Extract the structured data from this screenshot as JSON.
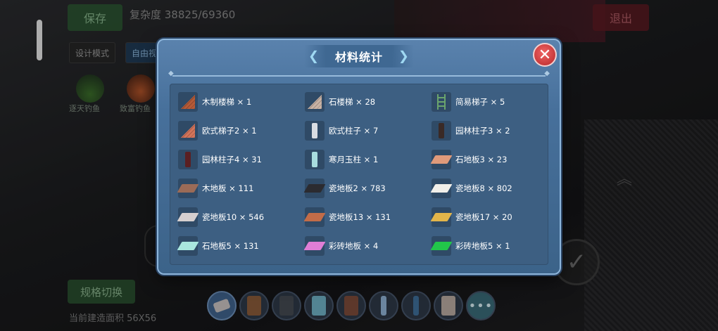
{
  "background": {
    "save_label": "保存",
    "complexity_text": "复杂度 38825/69360",
    "exit_label": "退出",
    "mode_design": "设计模式",
    "mode_free": "自由视",
    "avatar1_label": "逐天钓鱼",
    "avatar2_label": "致富钓鱼",
    "spec_switch_label": "规格切换",
    "area_text": "当前建造面积 56X56"
  },
  "dialog": {
    "title": "材料统计",
    "close_symbol": "✕"
  },
  "materials": [
    {
      "label": "木制楼梯 × 1",
      "icon": "wood-stairs-icon",
      "kind": "stairs",
      "color": "#b55a37"
    },
    {
      "label": "石楼梯 × 28",
      "icon": "stone-stairs-icon",
      "kind": "stairs",
      "color": "#c9b3a5"
    },
    {
      "label": "简易梯子 × 5",
      "icon": "simple-ladder-icon",
      "kind": "ladder",
      "color": "#6aa46d"
    },
    {
      "label": "欧式梯子2 × 1",
      "icon": "euro-ladder-icon",
      "kind": "stairs",
      "color": "#d3745a"
    },
    {
      "label": "欧式柱子 × 7",
      "icon": "euro-pillar-icon",
      "kind": "pillar",
      "color": "#d9dde3"
    },
    {
      "label": "园林柱子3 × 2",
      "icon": "garden-pillar-icon",
      "kind": "pillar",
      "color": "#3a2a26"
    },
    {
      "label": "园林柱子4 × 31",
      "icon": "garden-pillar-dark-icon",
      "kind": "pillar",
      "color": "#5a1f22"
    },
    {
      "label": "寒月玉柱 × 1",
      "icon": "jade-pillar-icon",
      "kind": "pillar",
      "color": "#a8dcde"
    },
    {
      "label": "石地板3 × 23",
      "icon": "stone-floor-icon",
      "kind": "tile",
      "color": "#e09a7a"
    },
    {
      "label": "木地板 × 111",
      "icon": "wood-floor-icon",
      "kind": "tile",
      "color": "#9b6b57"
    },
    {
      "label": "瓷地板2 × 783",
      "icon": "ceramic-floor-dark-icon",
      "kind": "tile",
      "color": "#2b2b30"
    },
    {
      "label": "瓷地板8 × 802",
      "icon": "ceramic-floor-white-icon",
      "kind": "tile",
      "color": "#f1efe9"
    },
    {
      "label": "瓷地板10 × 546",
      "icon": "ceramic-floor-grey-icon",
      "kind": "tile",
      "color": "#d6cfcf"
    },
    {
      "label": "瓷地板13 × 131",
      "icon": "ceramic-floor-orange-icon",
      "kind": "tile",
      "color": "#c26c48"
    },
    {
      "label": "瓷地板17 × 20",
      "icon": "ceramic-floor-pattern-icon",
      "kind": "tile",
      "color": "#e2b54a"
    },
    {
      "label": "石地板5 × 131",
      "icon": "stone-floor-cyan-icon",
      "kind": "tile",
      "color": "#a9e6de"
    },
    {
      "label": "彩砖地板 × 4",
      "icon": "color-brick-pink-icon",
      "kind": "tile",
      "color": "#e07ed6"
    },
    {
      "label": "彩砖地板5 × 1",
      "icon": "color-brick-green-icon",
      "kind": "tile",
      "color": "#22c64a"
    }
  ],
  "toolbar": {
    "items": [
      {
        "icon": "eraser-icon",
        "color": "#c8c2c0"
      },
      {
        "icon": "door-icon",
        "color": "#8a5b3a"
      },
      {
        "icon": "dark-panel-icon",
        "color": "#444a52"
      },
      {
        "icon": "fountain-icon",
        "color": "#6fb0c4"
      },
      {
        "icon": "bracket-icon",
        "color": "#7c4b3a"
      },
      {
        "icon": "column-icon",
        "color": "#8fb2d4"
      },
      {
        "icon": "blue-column-icon",
        "color": "#3f6f9a"
      },
      {
        "icon": "stairs-icon",
        "color": "#b9aaa0"
      }
    ],
    "more_label": "•••"
  }
}
